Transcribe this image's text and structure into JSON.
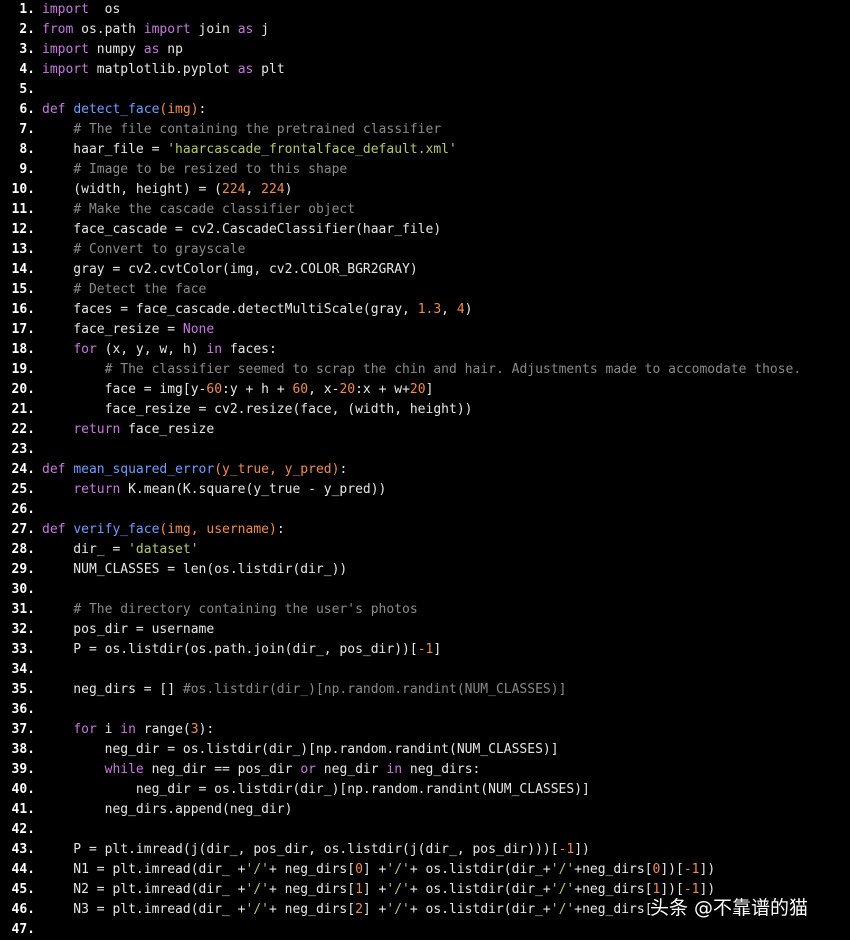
{
  "editor": {
    "lines": [
      {
        "n": "1.",
        "tokens": [
          [
            "kw",
            "import"
          ],
          [
            "",
            "  os"
          ]
        ]
      },
      {
        "n": "2.",
        "tokens": [
          [
            "kw",
            "from"
          ],
          [
            "",
            " os.path "
          ],
          [
            "kw",
            "import"
          ],
          [
            "",
            " join "
          ],
          [
            "kw",
            "as"
          ],
          [
            "",
            " j"
          ]
        ]
      },
      {
        "n": "3.",
        "tokens": [
          [
            "kw",
            "import"
          ],
          [
            "",
            " numpy "
          ],
          [
            "kw",
            "as"
          ],
          [
            "",
            " np"
          ]
        ]
      },
      {
        "n": "4.",
        "tokens": [
          [
            "kw",
            "import"
          ],
          [
            "",
            " matplotlib.pyplot "
          ],
          [
            "kw",
            "as"
          ],
          [
            "",
            " plt"
          ]
        ]
      },
      {
        "n": "5.",
        "tokens": []
      },
      {
        "n": "6.",
        "tokens": [
          [
            "kw",
            "def"
          ],
          [
            "",
            " "
          ],
          [
            "fn",
            "detect_face"
          ],
          [
            "prm",
            "(img)"
          ],
          [
            "",
            ":"
          ]
        ]
      },
      {
        "n": "7.",
        "tokens": [
          [
            "",
            "    "
          ],
          [
            "cm",
            "# The file containing the pretrained classifier"
          ]
        ]
      },
      {
        "n": "8.",
        "tokens": [
          [
            "",
            "    haar_file = "
          ],
          [
            "str",
            "'haarcascade_frontalface_default.xml'"
          ]
        ]
      },
      {
        "n": "9.",
        "tokens": [
          [
            "",
            "    "
          ],
          [
            "cm",
            "# Image to be resized to this shape"
          ]
        ]
      },
      {
        "n": "10.",
        "tokens": [
          [
            "",
            "    (width, height) = ("
          ],
          [
            "num",
            "224"
          ],
          [
            "",
            ", "
          ],
          [
            "num",
            "224"
          ],
          [
            "",
            ")"
          ]
        ]
      },
      {
        "n": "11.",
        "tokens": [
          [
            "",
            "    "
          ],
          [
            "cm",
            "# Make the cascade classifier object"
          ]
        ]
      },
      {
        "n": "12.",
        "tokens": [
          [
            "",
            "    face_cascade = cv2.CascadeClassifier(haar_file)"
          ]
        ]
      },
      {
        "n": "13.",
        "tokens": [
          [
            "",
            "    "
          ],
          [
            "cm",
            "# Convert to grayscale"
          ]
        ]
      },
      {
        "n": "14.",
        "tokens": [
          [
            "",
            "    gray = cv2.cvtColor(img, cv2.COLOR_BGR2GRAY)"
          ]
        ]
      },
      {
        "n": "15.",
        "tokens": [
          [
            "",
            "    "
          ],
          [
            "cm",
            "# Detect the face"
          ]
        ]
      },
      {
        "n": "16.",
        "tokens": [
          [
            "",
            "    faces = face_cascade.detectMultiScale(gray, "
          ],
          [
            "num",
            "1.3"
          ],
          [
            "",
            ", "
          ],
          [
            "num",
            "4"
          ],
          [
            "",
            ")"
          ]
        ]
      },
      {
        "n": "17.",
        "tokens": [
          [
            "",
            "    face_resize = "
          ],
          [
            "kw",
            "None"
          ]
        ]
      },
      {
        "n": "18.",
        "tokens": [
          [
            "",
            "    "
          ],
          [
            "kw",
            "for"
          ],
          [
            "",
            " (x, y, w, h) "
          ],
          [
            "kw",
            "in"
          ],
          [
            "",
            " faces:"
          ]
        ]
      },
      {
        "n": "19.",
        "tokens": [
          [
            "",
            "        "
          ],
          [
            "cm",
            "# The classifier seemed to scrap the chin and hair. Adjustments made to accomodate those."
          ]
        ]
      },
      {
        "n": "20.",
        "tokens": [
          [
            "",
            "        face = img[y-"
          ],
          [
            "num",
            "60"
          ],
          [
            "",
            ":y + h + "
          ],
          [
            "num",
            "60"
          ],
          [
            "",
            ", x-"
          ],
          [
            "num",
            "20"
          ],
          [
            "",
            ":x + w+"
          ],
          [
            "num",
            "20"
          ],
          [
            "",
            "]"
          ]
        ]
      },
      {
        "n": "21.",
        "tokens": [
          [
            "",
            "        face_resize = cv2.resize(face, (width, height))"
          ]
        ]
      },
      {
        "n": "22.",
        "tokens": [
          [
            "",
            "    "
          ],
          [
            "kw",
            "return"
          ],
          [
            "",
            " face_resize"
          ]
        ]
      },
      {
        "n": "23.",
        "tokens": []
      },
      {
        "n": "24.",
        "tokens": [
          [
            "kw",
            "def"
          ],
          [
            "",
            " "
          ],
          [
            "fn",
            "mean_squared_error"
          ],
          [
            "prm",
            "(y_true, y_pred)"
          ],
          [
            "",
            ":"
          ]
        ]
      },
      {
        "n": "25.",
        "tokens": [
          [
            "",
            "    "
          ],
          [
            "kw",
            "return"
          ],
          [
            "",
            " K.mean(K.square(y_true - y_pred))"
          ]
        ]
      },
      {
        "n": "26.",
        "tokens": []
      },
      {
        "n": "27.",
        "tokens": [
          [
            "kw",
            "def"
          ],
          [
            "",
            " "
          ],
          [
            "fn",
            "verify_face"
          ],
          [
            "prm",
            "(img, username)"
          ],
          [
            "",
            ":"
          ]
        ]
      },
      {
        "n": "28.",
        "tokens": [
          [
            "",
            "    dir_ = "
          ],
          [
            "str",
            "'dataset'"
          ]
        ]
      },
      {
        "n": "29.",
        "tokens": [
          [
            "",
            "    NUM_CLASSES = len(os.listdir(dir_))"
          ]
        ]
      },
      {
        "n": "30.",
        "tokens": []
      },
      {
        "n": "31.",
        "tokens": [
          [
            "",
            "    "
          ],
          [
            "cm",
            "# The directory containing the user's photos"
          ]
        ]
      },
      {
        "n": "32.",
        "tokens": [
          [
            "",
            "    pos_dir = username"
          ]
        ]
      },
      {
        "n": "33.",
        "tokens": [
          [
            "",
            "    P = os.listdir(os.path.join(dir_, pos_dir))["
          ],
          [
            "num",
            "-1"
          ],
          [
            "",
            "]"
          ]
        ]
      },
      {
        "n": "34.",
        "tokens": []
      },
      {
        "n": "35.",
        "tokens": [
          [
            "",
            "    neg_dirs = [] "
          ],
          [
            "cm",
            "#os.listdir(dir_)[np.random.randint(NUM_CLASSES)]"
          ]
        ]
      },
      {
        "n": "36.",
        "tokens": []
      },
      {
        "n": "37.",
        "tokens": [
          [
            "",
            "    "
          ],
          [
            "kw",
            "for"
          ],
          [
            "",
            " i "
          ],
          [
            "kw",
            "in"
          ],
          [
            "",
            " range("
          ],
          [
            "num",
            "3"
          ],
          [
            "",
            "):"
          ]
        ]
      },
      {
        "n": "38.",
        "tokens": [
          [
            "",
            "        neg_dir = os.listdir(dir_)[np.random.randint(NUM_CLASSES)]"
          ]
        ]
      },
      {
        "n": "39.",
        "tokens": [
          [
            "",
            "        "
          ],
          [
            "kw",
            "while"
          ],
          [
            "",
            " neg_dir == pos_dir "
          ],
          [
            "kw",
            "or"
          ],
          [
            "",
            " neg_dir "
          ],
          [
            "kw",
            "in"
          ],
          [
            "",
            " neg_dirs:"
          ]
        ]
      },
      {
        "n": "40.",
        "tokens": [
          [
            "",
            "            neg_dir = os.listdir(dir_)[np.random.randint(NUM_CLASSES)]"
          ]
        ]
      },
      {
        "n": "41.",
        "tokens": [
          [
            "",
            "        neg_dirs.append(neg_dir)"
          ]
        ]
      },
      {
        "n": "42.",
        "tokens": []
      },
      {
        "n": "43.",
        "tokens": [
          [
            "",
            "    P = plt.imread(j(dir_, pos_dir, os.listdir(j(dir_, pos_dir)))["
          ],
          [
            "num",
            "-1"
          ],
          [
            "",
            "])"
          ]
        ]
      },
      {
        "n": "44.",
        "tokens": [
          [
            "",
            "    N1 = plt.imread(dir_ +"
          ],
          [
            "str",
            "'/'"
          ],
          [
            "",
            "+ neg_dirs["
          ],
          [
            "num",
            "0"
          ],
          [
            "",
            "] +"
          ],
          [
            "str",
            "'/'"
          ],
          [
            "",
            "+ os.listdir(dir_+"
          ],
          [
            "str",
            "'/'"
          ],
          [
            "",
            "+neg_dirs["
          ],
          [
            "num",
            "0"
          ],
          [
            "",
            "])["
          ],
          [
            "num",
            "-1"
          ],
          [
            "",
            "])"
          ]
        ]
      },
      {
        "n": "45.",
        "tokens": [
          [
            "",
            "    N2 = plt.imread(dir_ +"
          ],
          [
            "str",
            "'/'"
          ],
          [
            "",
            "+ neg_dirs["
          ],
          [
            "num",
            "1"
          ],
          [
            "",
            "] +"
          ],
          [
            "str",
            "'/'"
          ],
          [
            "",
            "+ os.listdir(dir_+"
          ],
          [
            "str",
            "'/'"
          ],
          [
            "",
            "+neg_dirs["
          ],
          [
            "num",
            "1"
          ],
          [
            "",
            "])["
          ],
          [
            "num",
            "-1"
          ],
          [
            "",
            "])"
          ]
        ]
      },
      {
        "n": "46.",
        "tokens": [
          [
            "",
            "    N3 = plt.imread(dir_ +"
          ],
          [
            "str",
            "'/'"
          ],
          [
            "",
            "+ neg_dirs["
          ],
          [
            "num",
            "2"
          ],
          [
            "",
            "] +"
          ],
          [
            "str",
            "'/'"
          ],
          [
            "",
            "+ os.listdir(dir_+"
          ],
          [
            "str",
            "'/'"
          ],
          [
            "",
            "+neg_dirs["
          ]
        ]
      },
      {
        "n": "47.",
        "tokens": []
      }
    ]
  },
  "watermark": {
    "text": "头条 @不靠谱的猫"
  },
  "colors": {
    "background": "#000000",
    "text": "#e6e6e6",
    "keyword": "#c678dd",
    "function": "#6f9cff",
    "number": "#f08d49",
    "string": "#b5c96a",
    "comment": "#8a8a8a"
  }
}
